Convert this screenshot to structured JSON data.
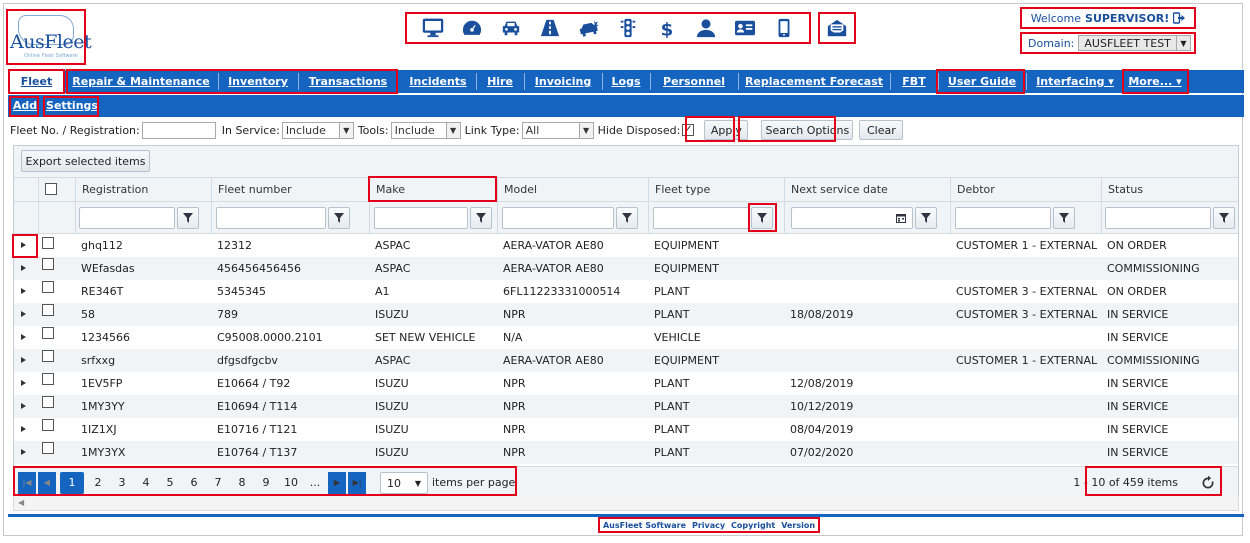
{
  "header": {
    "logo_text": "AusFleet",
    "logo_tagline": "Online Fleet Software",
    "welcome_prefix": "Welcome",
    "user_name": "SUPERVISOR!",
    "domain_label": "Domain:",
    "domain_value": "AUSFLEET TEST",
    "icons": [
      "monitor-icon",
      "dashboard-icon",
      "car-icon",
      "road-icon",
      "car-crash-icon",
      "traffic-light-icon",
      "dollar-icon",
      "user-icon",
      "id-card-icon",
      "mobile-icon"
    ],
    "message_icon": "envelope-open-icon"
  },
  "nav": {
    "items": [
      "Fleet",
      "Repair & Maintenance",
      "Inventory",
      "Transactions",
      "Incidents",
      "Hire",
      "Invoicing",
      "Logs",
      "Personnel",
      "Replacement Forecast",
      "FBT",
      "User Guide",
      "Interfacing ▾",
      "More... ▾"
    ],
    "active": "Fleet"
  },
  "subnav": {
    "items": [
      "Add",
      "Settings"
    ]
  },
  "filters": {
    "fleet_reg_label": "Fleet No. / Registration:",
    "fleet_reg_value": "",
    "in_service_label": "In Service:",
    "in_service_value": "Include",
    "tools_label": "Tools:",
    "tools_value": "Include",
    "link_type_label": "Link Type:",
    "link_type_value": "All",
    "hide_disposed_label": "Hide Disposed:",
    "hide_disposed_checked": true,
    "apply_label": "Apply",
    "search_options_label": "Search Options",
    "clear_label": "Clear"
  },
  "grid": {
    "export_label": "Export selected items",
    "columns": [
      "Registration",
      "Fleet number",
      "Make",
      "Model",
      "Fleet type",
      "Next service date",
      "Debtor",
      "Status"
    ],
    "rows": [
      {
        "registration": "ghq112",
        "fleet_number": "12312",
        "make": "ASPAC",
        "model": "AERA-VATOR AE80",
        "fleet_type": "EQUIPMENT",
        "next_service": "",
        "debtor": "CUSTOMER 1 - EXTERNAL",
        "status": "ON ORDER"
      },
      {
        "registration": "WEfasdas",
        "fleet_number": "456456456456",
        "make": "ASPAC",
        "model": "AERA-VATOR AE80",
        "fleet_type": "EQUIPMENT",
        "next_service": "",
        "debtor": "",
        "status": "COMMISSIONING"
      },
      {
        "registration": "RE346T",
        "fleet_number": "5345345",
        "make": "A1",
        "model": "6FL11223331000514",
        "fleet_type": "PLANT",
        "next_service": "",
        "debtor": "CUSTOMER 3 - EXTERNAL",
        "status": "ON ORDER"
      },
      {
        "registration": "58",
        "fleet_number": "789",
        "make": "ISUZU",
        "model": "NPR",
        "fleet_type": "PLANT",
        "next_service": "18/08/2019",
        "debtor": "CUSTOMER 3 - EXTERNAL",
        "status": "IN SERVICE"
      },
      {
        "registration": "1234566",
        "fleet_number": "C95008.0000.2101",
        "make": "SET NEW VEHICLE",
        "model": "N/A",
        "fleet_type": "VEHICLE",
        "next_service": "",
        "debtor": "",
        "status": "IN SERVICE"
      },
      {
        "registration": "srfxxg",
        "fleet_number": "dfgsdfgcbv",
        "make": "ASPAC",
        "model": "AERA-VATOR AE80",
        "fleet_type": "EQUIPMENT",
        "next_service": "",
        "debtor": "CUSTOMER 1 - EXTERNAL",
        "status": "COMMISSIONING"
      },
      {
        "registration": "1EV5FP",
        "fleet_number": "E10664 / T92",
        "make": "ISUZU",
        "model": "NPR",
        "fleet_type": "PLANT",
        "next_service": "12/08/2019",
        "debtor": "",
        "status": "IN SERVICE"
      },
      {
        "registration": "1MY3YY",
        "fleet_number": "E10694 / T114",
        "make": "ISUZU",
        "model": "NPR",
        "fleet_type": "PLANT",
        "next_service": "10/12/2019",
        "debtor": "",
        "status": "IN SERVICE"
      },
      {
        "registration": "1IZ1XJ",
        "fleet_number": "E10716 / T121",
        "make": "ISUZU",
        "model": "NPR",
        "fleet_type": "PLANT",
        "next_service": "08/04/2019",
        "debtor": "",
        "status": "IN SERVICE"
      },
      {
        "registration": "1MY3YX",
        "fleet_number": "E10764 / T137",
        "make": "ISUZU",
        "model": "NPR",
        "fleet_type": "PLANT",
        "next_service": "07/02/2020",
        "debtor": "",
        "status": "IN SERVICE"
      }
    ]
  },
  "pager": {
    "pages": [
      "1",
      "2",
      "3",
      "4",
      "5",
      "6",
      "7",
      "8",
      "9",
      "10",
      "..."
    ],
    "current": "1",
    "per_page": "10",
    "per_page_label": "items per page",
    "items_info": "1 - 10 of 459 items"
  },
  "footer": {
    "links": [
      "AusFleet Software",
      "Privacy",
      "Copyright",
      "Version"
    ]
  },
  "colors": {
    "brand_blue": "#1565c0",
    "highlight_red": "#e2001a"
  }
}
